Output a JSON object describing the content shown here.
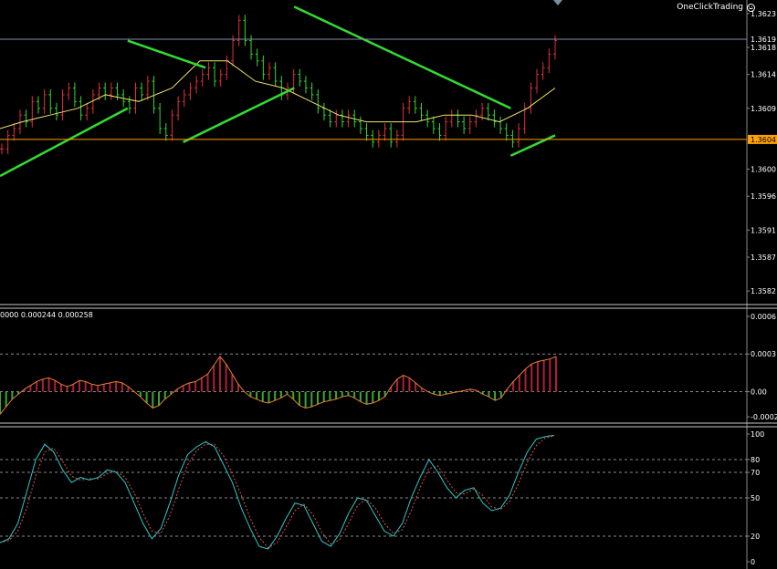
{
  "toolbar": {
    "one_click_label": "OneClickTrading",
    "smiley_icon": "smiley-icon"
  },
  "colors": {
    "background": "#000000",
    "bull_bar": "#e0303a",
    "bear_bar": "#33d833",
    "ma_line": "#f2e56a",
    "trend_line": "#32dc32",
    "h_line": "#ffa000",
    "h_line_2": "#8090b0",
    "hist_pos": "#b0203a",
    "hist_neg": "#3aa830",
    "osc_main": "#2ec8c8",
    "osc_signal": "#e05050",
    "grid": "#8a8a8a"
  },
  "chart_data": [
    {
      "type": "ohlc-price",
      "y_ticks": [
        "1.3623",
        "1.3618",
        "1.3614",
        "1.3609",
        "1.3600",
        "1.3596",
        "1.3591",
        "1.3587",
        "1.3582"
      ],
      "ylim": [
        1.358,
        1.3625
      ],
      "horizontal_lines": [
        {
          "price": 1.36192,
          "label": "1.3619",
          "color": "#8090b0"
        },
        {
          "price": 1.36044,
          "label": "1.3604",
          "color": "#ffa000"
        }
      ],
      "closes": [
        1.3603,
        1.3605,
        1.3606,
        1.3608,
        1.3607,
        1.361,
        1.3609,
        1.3611,
        1.3609,
        1.3608,
        1.3611,
        1.3612,
        1.361,
        1.3608,
        1.3609,
        1.3611,
        1.3612,
        1.3611,
        1.3612,
        1.3611,
        1.361,
        1.3609,
        1.3612,
        1.3611,
        1.3613,
        1.3609,
        1.3606,
        1.3605,
        1.3608,
        1.361,
        1.3611,
        1.3612,
        1.3613,
        1.3614,
        1.3615,
        1.3613,
        1.3614,
        1.3616,
        1.3619,
        1.3622,
        1.3619,
        1.3617,
        1.3616,
        1.3614,
        1.3615,
        1.3613,
        1.3611,
        1.3612,
        1.3614,
        1.3613,
        1.3612,
        1.3611,
        1.3609,
        1.3608,
        1.3607,
        1.3608,
        1.3607,
        1.3608,
        1.3607,
        1.3606,
        1.3605,
        1.3604,
        1.3605,
        1.3606,
        1.3604,
        1.3605,
        1.3609,
        1.361,
        1.3609,
        1.3608,
        1.3607,
        1.3606,
        1.3605,
        1.3607,
        1.3608,
        1.3607,
        1.3606,
        1.3607,
        1.3608,
        1.3609,
        1.3608,
        1.3607,
        1.3606,
        1.3605,
        1.3604,
        1.3606,
        1.3609,
        1.3612,
        1.3614,
        1.3615,
        1.3617,
        1.3619
      ],
      "moving_average": [
        {
          "x": 0.0,
          "price": 1.3606
        },
        {
          "x": 0.04,
          "price": 1.3607
        },
        {
          "x": 0.09,
          "price": 1.3608
        },
        {
          "x": 0.14,
          "price": 1.3609
        },
        {
          "x": 0.19,
          "price": 1.3611
        },
        {
          "x": 0.25,
          "price": 1.361
        },
        {
          "x": 0.31,
          "price": 1.3612
        },
        {
          "x": 0.36,
          "price": 1.3616
        },
        {
          "x": 0.41,
          "price": 1.3616
        },
        {
          "x": 0.46,
          "price": 1.3613
        },
        {
          "x": 0.51,
          "price": 1.3612
        },
        {
          "x": 0.56,
          "price": 1.361
        },
        {
          "x": 0.61,
          "price": 1.3608
        },
        {
          "x": 0.66,
          "price": 1.3607
        },
        {
          "x": 0.7,
          "price": 1.3607
        },
        {
          "x": 0.75,
          "price": 1.3607
        },
        {
          "x": 0.8,
          "price": 1.3608
        },
        {
          "x": 0.85,
          "price": 1.3608
        },
        {
          "x": 0.9,
          "price": 1.3607
        },
        {
          "x": 0.95,
          "price": 1.3609
        },
        {
          "x": 1.0,
          "price": 1.3612
        }
      ],
      "trend_lines": [
        {
          "from": {
            "x": 0.0,
            "price": 1.3599
          },
          "to": {
            "x": 0.23,
            "price": 1.3609
          }
        },
        {
          "from": {
            "x": 0.23,
            "price": 1.3619
          },
          "to": {
            "x": 0.37,
            "price": 1.3615
          }
        },
        {
          "from": {
            "x": 0.33,
            "price": 1.3604
          },
          "to": {
            "x": 0.53,
            "price": 1.3612
          }
        },
        {
          "from": {
            "x": 0.53,
            "price": 1.3624
          },
          "to": {
            "x": 0.92,
            "price": 1.3609
          }
        },
        {
          "from": {
            "x": 0.92,
            "price": 1.3602
          },
          "to": {
            "x": 1.0,
            "price": 1.3605
          }
        }
      ]
    },
    {
      "type": "histogram",
      "header": "0000 0.000244 0.000258",
      "y_ticks": [
        "0.0006",
        "0.0003",
        "0.00",
        "-0.0002"
      ],
      "ylim": [
        -0.00025,
        0.00065
      ],
      "level_lines": [
        0.0003,
        0.0
      ],
      "values": [
        -0.00018,
        -0.00012,
        -6e-05,
        -2e-05,
        2e-05,
        5e-05,
        8e-05,
        0.0001,
        0.00011,
        9e-05,
        6e-05,
        4e-05,
        6e-05,
        9e-05,
        8e-05,
        6e-05,
        5e-05,
        6e-05,
        7e-05,
        8e-05,
        7e-05,
        4e-05,
        0.0,
        -4e-05,
        -9e-05,
        -0.00013,
        -0.00011,
        -6e-05,
        -2e-05,
        2e-05,
        5e-05,
        7e-05,
        8e-05,
        0.00011,
        0.00014,
        0.00021,
        0.00028,
        0.00022,
        0.00014,
        6e-05,
        0.0,
        -4e-05,
        -6e-05,
        -8e-05,
        -9e-05,
        -7e-05,
        -5e-05,
        -2e-05,
        -6e-05,
        -0.00011,
        -0.00013,
        -0.00012,
        -0.0001,
        -8e-05,
        -7e-05,
        -6e-05,
        -4e-05,
        -3e-05,
        -5e-05,
        -8e-05,
        -0.0001,
        -9e-05,
        -7e-05,
        -4e-05,
        4e-05,
        0.0001,
        0.00013,
        0.00011,
        7e-05,
        3e-05,
        0.0,
        -2e-05,
        -3e-05,
        -2e-05,
        -1e-05,
        0.0,
        1e-05,
        2e-05,
        1e-05,
        -2e-05,
        -4e-05,
        -7e-05,
        -5e-05,
        2e-05,
        8e-05,
        0.00013,
        0.00018,
        0.00022,
        0.00024,
        0.00025,
        0.00026,
        0.00028
      ]
    },
    {
      "type": "line",
      "y_ticks": [
        "100",
        "80",
        "70",
        "50",
        "20",
        "0"
      ],
      "ylim": [
        0,
        100
      ],
      "level_lines": [
        80,
        70,
        50,
        20
      ],
      "series": [
        {
          "values": [
            15,
            18,
            30,
            55,
            80,
            92,
            86,
            72,
            62,
            66,
            64,
            66,
            72,
            70,
            62,
            46,
            30,
            18,
            26,
            46,
            68,
            84,
            90,
            94,
            90,
            76,
            62,
            42,
            26,
            12,
            10,
            20,
            34,
            46,
            44,
            30,
            16,
            12,
            22,
            38,
            50,
            48,
            36,
            24,
            20,
            30,
            50,
            66,
            80,
            70,
            58,
            50,
            56,
            58,
            46,
            40,
            42,
            52,
            70,
            86,
            96,
            98,
            99
          ]
        }
      ]
    }
  ]
}
